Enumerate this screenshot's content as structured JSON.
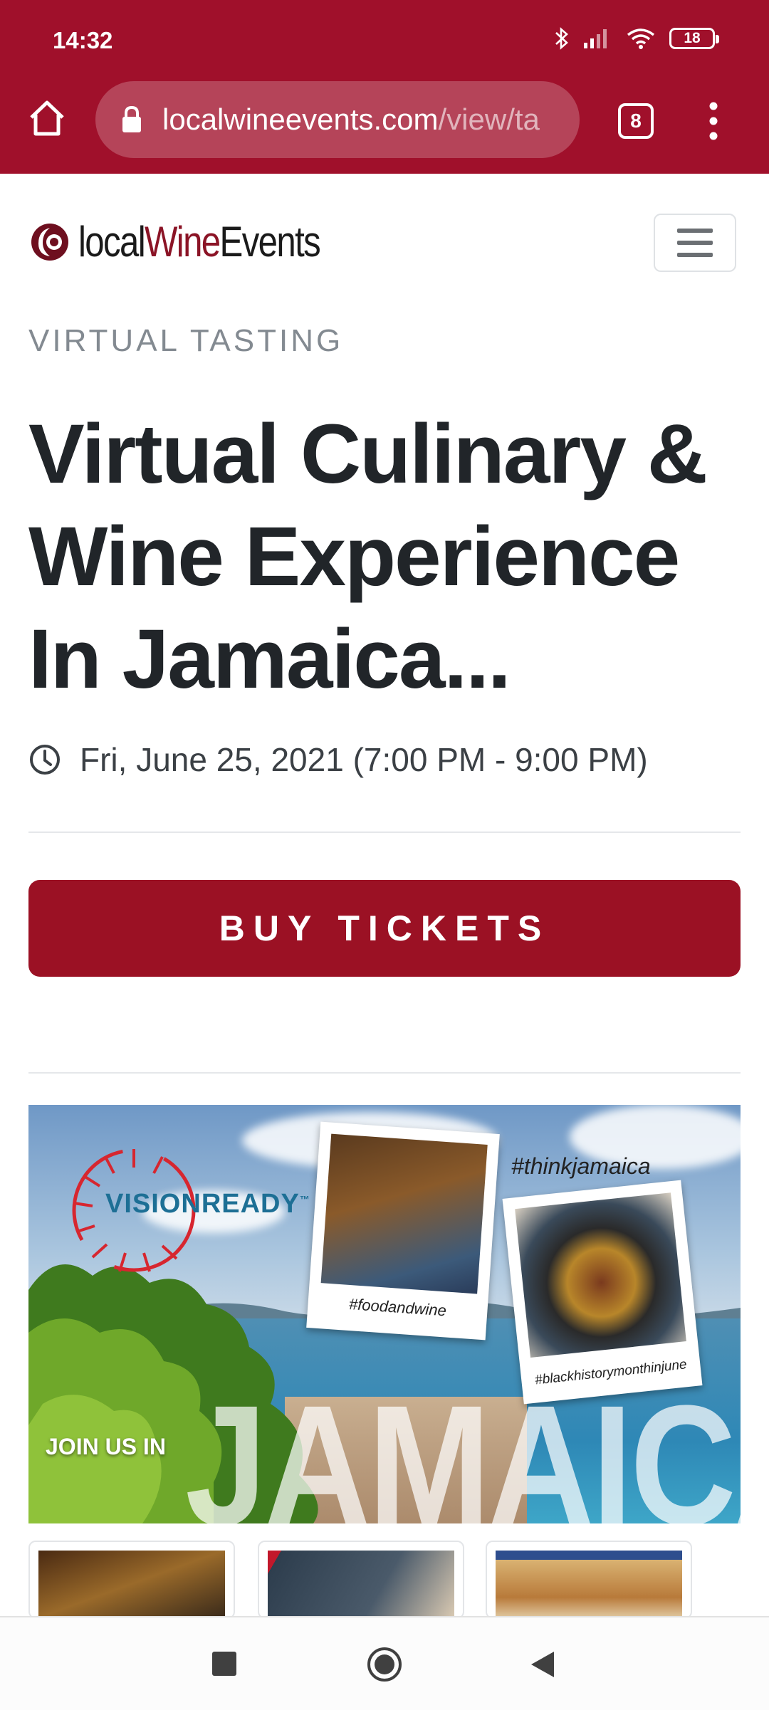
{
  "status_bar": {
    "time": "14:32",
    "battery": "18"
  },
  "browser": {
    "url_host": "localwineevents.com",
    "url_path": "/view/ta",
    "tab_count": "8"
  },
  "site": {
    "logo_prefix": "local",
    "logo_accent": "Wine",
    "logo_suffix": "Events"
  },
  "event": {
    "category": "VIRTUAL TASTING",
    "title": "Virtual Culinary & Wine Experience In Jamaica...",
    "datetime": "Fri, June 25, 2021 (7:00 PM - 9:00 PM)",
    "buy_label": "BUY TICKETS"
  },
  "promo": {
    "brand_left": "VISION",
    "brand_right": "READY",
    "tm": "™",
    "tag_think": "#thinkjamaica",
    "tag_food": "#foodandwine",
    "tag_history": "#blackhistorymonthinjune",
    "join_text": "JOIN US IN",
    "headline": "JAMAICA"
  },
  "colors": {
    "brand": "#a0102b",
    "button": "#9b1124",
    "text": "#212529",
    "muted": "#838a91"
  },
  "icons": [
    "home-icon",
    "lock-icon",
    "menu-dots-icon",
    "hamburger-icon",
    "clock-icon",
    "bluetooth-icon",
    "signal-icon",
    "wifi-icon"
  ]
}
